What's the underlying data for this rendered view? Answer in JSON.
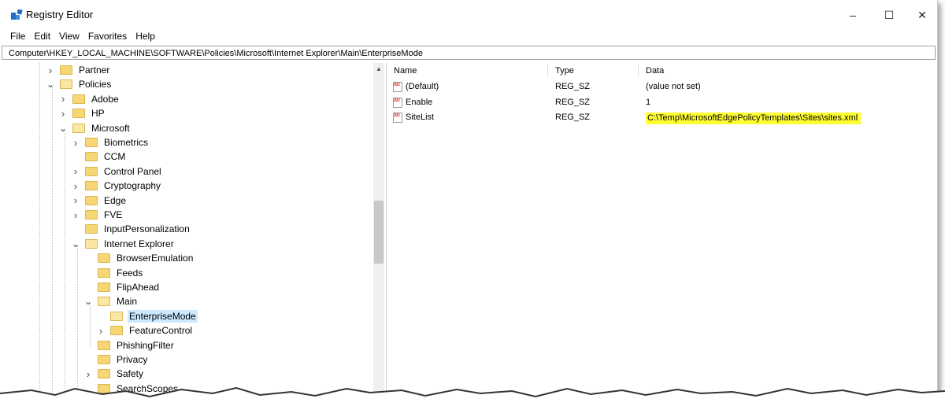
{
  "window": {
    "title": "Registry Editor",
    "minimize": "–",
    "maximize": "☐",
    "close": "✕"
  },
  "menu": [
    "File",
    "Edit",
    "View",
    "Favorites",
    "Help"
  ],
  "address": "Computer\\HKEY_LOCAL_MACHINE\\SOFTWARE\\Policies\\Microsoft\\Internet Explorer\\Main\\EnterpriseMode",
  "tree": [
    {
      "label": "Partner",
      "depth": 0,
      "expander": "collapsed"
    },
    {
      "label": "Policies",
      "depth": 0,
      "expander": "expanded"
    },
    {
      "label": "Adobe",
      "depth": 1,
      "expander": "collapsed"
    },
    {
      "label": "HP",
      "depth": 1,
      "expander": "collapsed"
    },
    {
      "label": "Microsoft",
      "depth": 1,
      "expander": "expanded"
    },
    {
      "label": "Biometrics",
      "depth": 2,
      "expander": "collapsed"
    },
    {
      "label": "CCM",
      "depth": 2,
      "expander": "none"
    },
    {
      "label": "Control Panel",
      "depth": 2,
      "expander": "collapsed"
    },
    {
      "label": "Cryptography",
      "depth": 2,
      "expander": "collapsed"
    },
    {
      "label": "Edge",
      "depth": 2,
      "expander": "collapsed"
    },
    {
      "label": "FVE",
      "depth": 2,
      "expander": "collapsed"
    },
    {
      "label": "InputPersonalization",
      "depth": 2,
      "expander": "none"
    },
    {
      "label": "Internet Explorer",
      "depth": 2,
      "expander": "expanded"
    },
    {
      "label": "BrowserEmulation",
      "depth": 3,
      "expander": "none"
    },
    {
      "label": "Feeds",
      "depth": 3,
      "expander": "none"
    },
    {
      "label": "FlipAhead",
      "depth": 3,
      "expander": "none"
    },
    {
      "label": "Main",
      "depth": 3,
      "expander": "expanded"
    },
    {
      "label": "EnterpriseMode",
      "depth": 4,
      "expander": "none",
      "selected": true
    },
    {
      "label": "FeatureControl",
      "depth": 4,
      "expander": "collapsed"
    },
    {
      "label": "PhishingFilter",
      "depth": 3,
      "expander": "none"
    },
    {
      "label": "Privacy",
      "depth": 3,
      "expander": "none"
    },
    {
      "label": "Safety",
      "depth": 3,
      "expander": "collapsed"
    },
    {
      "label": "SearchScopes",
      "depth": 3,
      "expander": "none"
    }
  ],
  "columns": {
    "name": "Name",
    "type": "Type",
    "data": "Data"
  },
  "values": [
    {
      "name": "(Default)",
      "type": "REG_SZ",
      "data": "(value not set)",
      "highlight": false
    },
    {
      "name": "Enable",
      "type": "REG_SZ",
      "data": "1",
      "highlight": false
    },
    {
      "name": "SiteList",
      "type": "REG_SZ",
      "data": "C:\\Temp\\MicrosoftEdgePolicyTemplates\\Sites\\sites.xml",
      "highlight": true
    }
  ],
  "colors": {
    "selection": "#cce8ff",
    "highlight": "#ffff33",
    "folder": "#f7d775"
  }
}
